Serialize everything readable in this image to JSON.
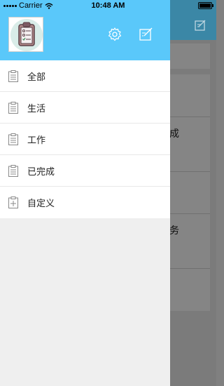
{
  "status_bar": {
    "carrier": "Carrier",
    "time": "10:48 AM"
  },
  "background": {
    "text_1": "的完成",
    "text_2": "个任务"
  },
  "drawer": {
    "menu": [
      {
        "label": "全部",
        "icon": "clipboard-icon"
      },
      {
        "label": "生活",
        "icon": "clipboard-icon"
      },
      {
        "label": "工作",
        "icon": "clipboard-icon"
      },
      {
        "label": "已完成",
        "icon": "clipboard-icon"
      },
      {
        "label": "自定义",
        "icon": "clipboard-plus-icon"
      }
    ]
  },
  "colors": {
    "header": "#5ac8fa",
    "drawer_bg": "#efefef",
    "dimmed_header": "#3b87a6"
  }
}
